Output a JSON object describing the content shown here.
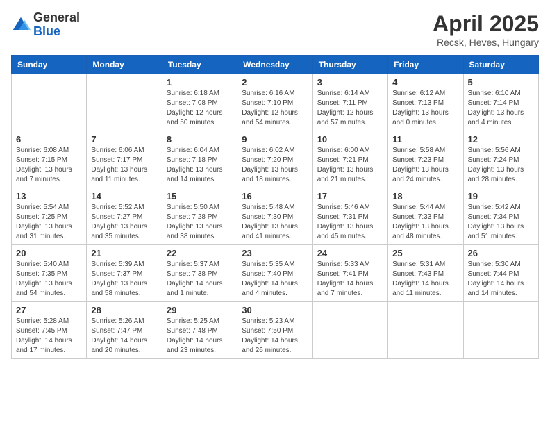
{
  "header": {
    "logo_general": "General",
    "logo_blue": "Blue",
    "title": "April 2025",
    "location": "Recsk, Heves, Hungary"
  },
  "days_of_week": [
    "Sunday",
    "Monday",
    "Tuesday",
    "Wednesday",
    "Thursday",
    "Friday",
    "Saturday"
  ],
  "weeks": [
    [
      {
        "day": "",
        "info": ""
      },
      {
        "day": "",
        "info": ""
      },
      {
        "day": "1",
        "info": "Sunrise: 6:18 AM\nSunset: 7:08 PM\nDaylight: 12 hours and 50 minutes."
      },
      {
        "day": "2",
        "info": "Sunrise: 6:16 AM\nSunset: 7:10 PM\nDaylight: 12 hours and 54 minutes."
      },
      {
        "day": "3",
        "info": "Sunrise: 6:14 AM\nSunset: 7:11 PM\nDaylight: 12 hours and 57 minutes."
      },
      {
        "day": "4",
        "info": "Sunrise: 6:12 AM\nSunset: 7:13 PM\nDaylight: 13 hours and 0 minutes."
      },
      {
        "day": "5",
        "info": "Sunrise: 6:10 AM\nSunset: 7:14 PM\nDaylight: 13 hours and 4 minutes."
      }
    ],
    [
      {
        "day": "6",
        "info": "Sunrise: 6:08 AM\nSunset: 7:15 PM\nDaylight: 13 hours and 7 minutes."
      },
      {
        "day": "7",
        "info": "Sunrise: 6:06 AM\nSunset: 7:17 PM\nDaylight: 13 hours and 11 minutes."
      },
      {
        "day": "8",
        "info": "Sunrise: 6:04 AM\nSunset: 7:18 PM\nDaylight: 13 hours and 14 minutes."
      },
      {
        "day": "9",
        "info": "Sunrise: 6:02 AM\nSunset: 7:20 PM\nDaylight: 13 hours and 18 minutes."
      },
      {
        "day": "10",
        "info": "Sunrise: 6:00 AM\nSunset: 7:21 PM\nDaylight: 13 hours and 21 minutes."
      },
      {
        "day": "11",
        "info": "Sunrise: 5:58 AM\nSunset: 7:23 PM\nDaylight: 13 hours and 24 minutes."
      },
      {
        "day": "12",
        "info": "Sunrise: 5:56 AM\nSunset: 7:24 PM\nDaylight: 13 hours and 28 minutes."
      }
    ],
    [
      {
        "day": "13",
        "info": "Sunrise: 5:54 AM\nSunset: 7:25 PM\nDaylight: 13 hours and 31 minutes."
      },
      {
        "day": "14",
        "info": "Sunrise: 5:52 AM\nSunset: 7:27 PM\nDaylight: 13 hours and 35 minutes."
      },
      {
        "day": "15",
        "info": "Sunrise: 5:50 AM\nSunset: 7:28 PM\nDaylight: 13 hours and 38 minutes."
      },
      {
        "day": "16",
        "info": "Sunrise: 5:48 AM\nSunset: 7:30 PM\nDaylight: 13 hours and 41 minutes."
      },
      {
        "day": "17",
        "info": "Sunrise: 5:46 AM\nSunset: 7:31 PM\nDaylight: 13 hours and 45 minutes."
      },
      {
        "day": "18",
        "info": "Sunrise: 5:44 AM\nSunset: 7:33 PM\nDaylight: 13 hours and 48 minutes."
      },
      {
        "day": "19",
        "info": "Sunrise: 5:42 AM\nSunset: 7:34 PM\nDaylight: 13 hours and 51 minutes."
      }
    ],
    [
      {
        "day": "20",
        "info": "Sunrise: 5:40 AM\nSunset: 7:35 PM\nDaylight: 13 hours and 54 minutes."
      },
      {
        "day": "21",
        "info": "Sunrise: 5:39 AM\nSunset: 7:37 PM\nDaylight: 13 hours and 58 minutes."
      },
      {
        "day": "22",
        "info": "Sunrise: 5:37 AM\nSunset: 7:38 PM\nDaylight: 14 hours and 1 minute."
      },
      {
        "day": "23",
        "info": "Sunrise: 5:35 AM\nSunset: 7:40 PM\nDaylight: 14 hours and 4 minutes."
      },
      {
        "day": "24",
        "info": "Sunrise: 5:33 AM\nSunset: 7:41 PM\nDaylight: 14 hours and 7 minutes."
      },
      {
        "day": "25",
        "info": "Sunrise: 5:31 AM\nSunset: 7:43 PM\nDaylight: 14 hours and 11 minutes."
      },
      {
        "day": "26",
        "info": "Sunrise: 5:30 AM\nSunset: 7:44 PM\nDaylight: 14 hours and 14 minutes."
      }
    ],
    [
      {
        "day": "27",
        "info": "Sunrise: 5:28 AM\nSunset: 7:45 PM\nDaylight: 14 hours and 17 minutes."
      },
      {
        "day": "28",
        "info": "Sunrise: 5:26 AM\nSunset: 7:47 PM\nDaylight: 14 hours and 20 minutes."
      },
      {
        "day": "29",
        "info": "Sunrise: 5:25 AM\nSunset: 7:48 PM\nDaylight: 14 hours and 23 minutes."
      },
      {
        "day": "30",
        "info": "Sunrise: 5:23 AM\nSunset: 7:50 PM\nDaylight: 14 hours and 26 minutes."
      },
      {
        "day": "",
        "info": ""
      },
      {
        "day": "",
        "info": ""
      },
      {
        "day": "",
        "info": ""
      }
    ]
  ]
}
